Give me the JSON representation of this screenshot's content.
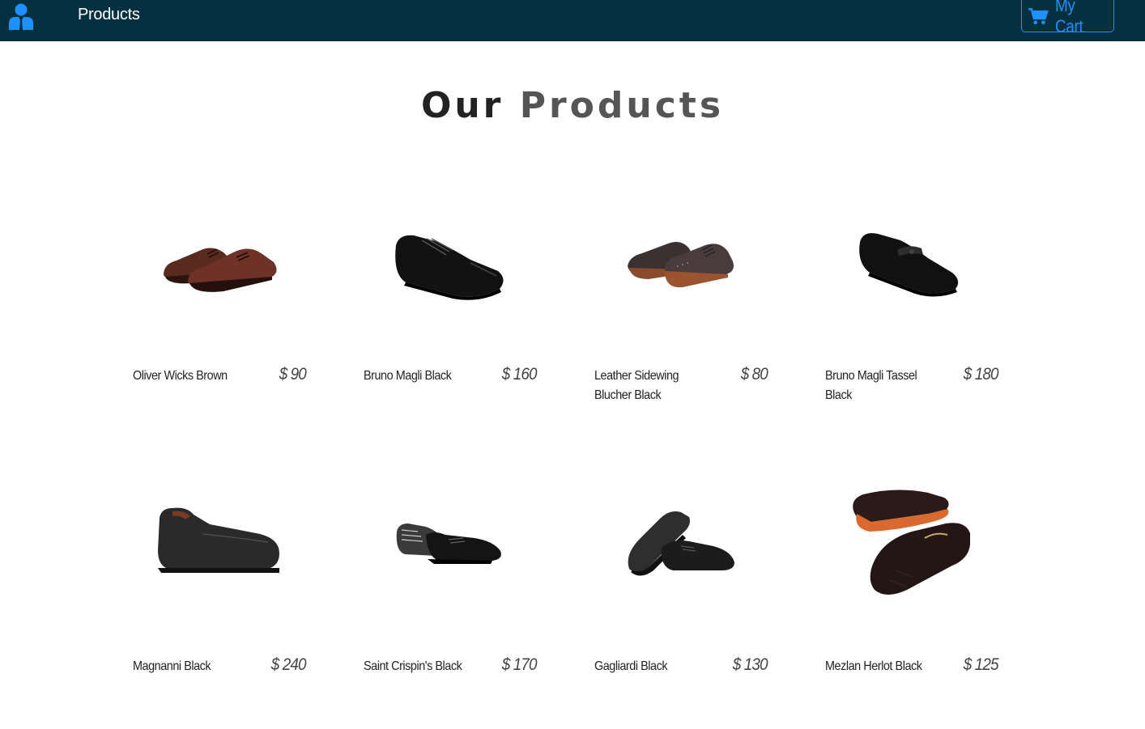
{
  "nav": {
    "logo_icon": "user-icon",
    "link_label": "Products",
    "cart_icon": "shopping-cart-icon",
    "cart_label": "My Cart",
    "accent_color": "#1e90ff",
    "background_color": "#04303f"
  },
  "title": {
    "word1": "Our",
    "word2": "Products"
  },
  "products": [
    {
      "name": "Oliver Wicks Brown",
      "price": "$ 90",
      "image": "brown-oxford-shoes"
    },
    {
      "name": "Bruno Magli Black",
      "price": "$ 160",
      "image": "black-derby-shoe"
    },
    {
      "name": "Leather Sidewing Blucher Black",
      "price": "$ 80",
      "image": "brogue-blucher-shoes"
    },
    {
      "name": "Bruno Magli Tassel Black",
      "price": "$ 180",
      "image": "black-tassel-loafer"
    },
    {
      "name": "Magnanni Black",
      "price": "$ 240",
      "image": "black-slip-on-shoe"
    },
    {
      "name": "Saint Crispin's Black",
      "price": "$ 170",
      "image": "black-cap-toe-shoes"
    },
    {
      "name": "Gagliardi Black",
      "price": "$ 130",
      "image": "black-oxford-pair"
    },
    {
      "name": "Mezlan Herlot Black",
      "price": "$ 125",
      "image": "black-horsebit-loafers"
    }
  ]
}
